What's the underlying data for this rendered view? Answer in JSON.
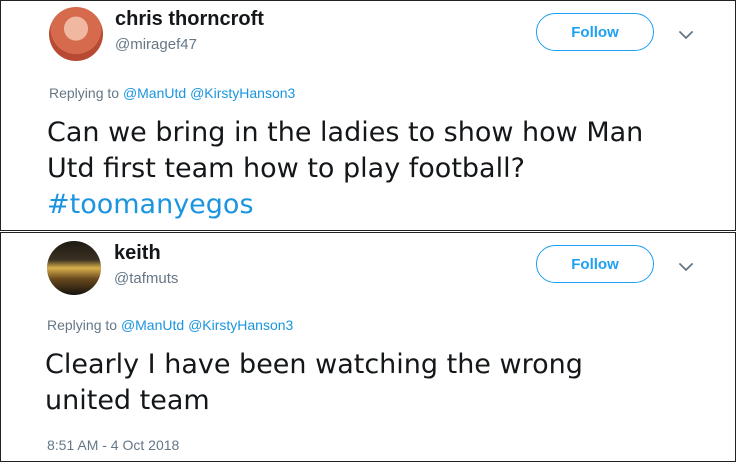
{
  "tweets": [
    {
      "name": "chris thorncroft",
      "handle": "@miragef47",
      "follow_label": "Follow",
      "replying_prefix": "Replying to",
      "mentions": [
        "@ManUtd",
        "@KirstyHanson3"
      ],
      "text_line1": "Can we bring in the ladies to show how Man",
      "text_line2": "Utd first team how to play football?",
      "hashtag": "#toomanyegos"
    },
    {
      "name": "keith",
      "handle": "@tafmuts",
      "follow_label": "Follow",
      "replying_prefix": "Replying to",
      "mentions": [
        "@ManUtd",
        "@KirstyHanson3"
      ],
      "text_line1": "Clearly I have been watching the wrong",
      "text_line2": "united team",
      "timestamp": "8:51 AM - 4 Oct 2018"
    }
  ],
  "colors": {
    "link": "#1b95e0",
    "follow": "#1da1f2",
    "secondary_text": "#657786"
  },
  "icons": {
    "menu": "chevron-down-icon"
  }
}
